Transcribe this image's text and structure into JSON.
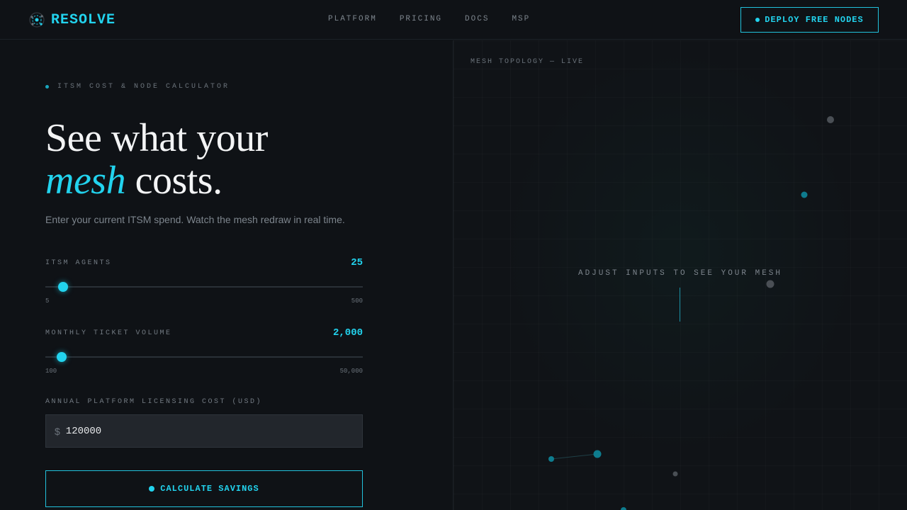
{
  "brand": {
    "name": "RESOLVE",
    "accent": "#22d3ee"
  },
  "nav": [
    "PLATFORM",
    "PRICING",
    "DOCS",
    "MSP"
  ],
  "header": {
    "cta_label": "DEPLOY FREE NODES"
  },
  "calculator": {
    "eyebrow": "ITSM COST & NODE CALCULATOR",
    "headline_line1": "See what your",
    "headline_em": "mesh",
    "headline_rest": " costs.",
    "subtitle": "Enter your current ITSM spend. Watch the mesh redraw in real time.",
    "agents": {
      "label": "ITSM AGENTS",
      "value": "25",
      "min": "5",
      "max": "500",
      "level": 0.0404
    },
    "tickets": {
      "label": "MONTHLY TICKET VOLUME",
      "value": "2,000",
      "min": "100",
      "max": "50,000",
      "level": 0.038
    },
    "licensing": {
      "label": "ANNUAL PLATFORM LICENSING COST (USD)",
      "currency": "$",
      "value": "120000"
    },
    "button_label": "CALCULATE SAVINGS"
  },
  "mesh": {
    "title": "MESH TOPOLOGY — LIVE",
    "hint": "ADJUST INPUTS TO SEE YOUR MESH"
  }
}
